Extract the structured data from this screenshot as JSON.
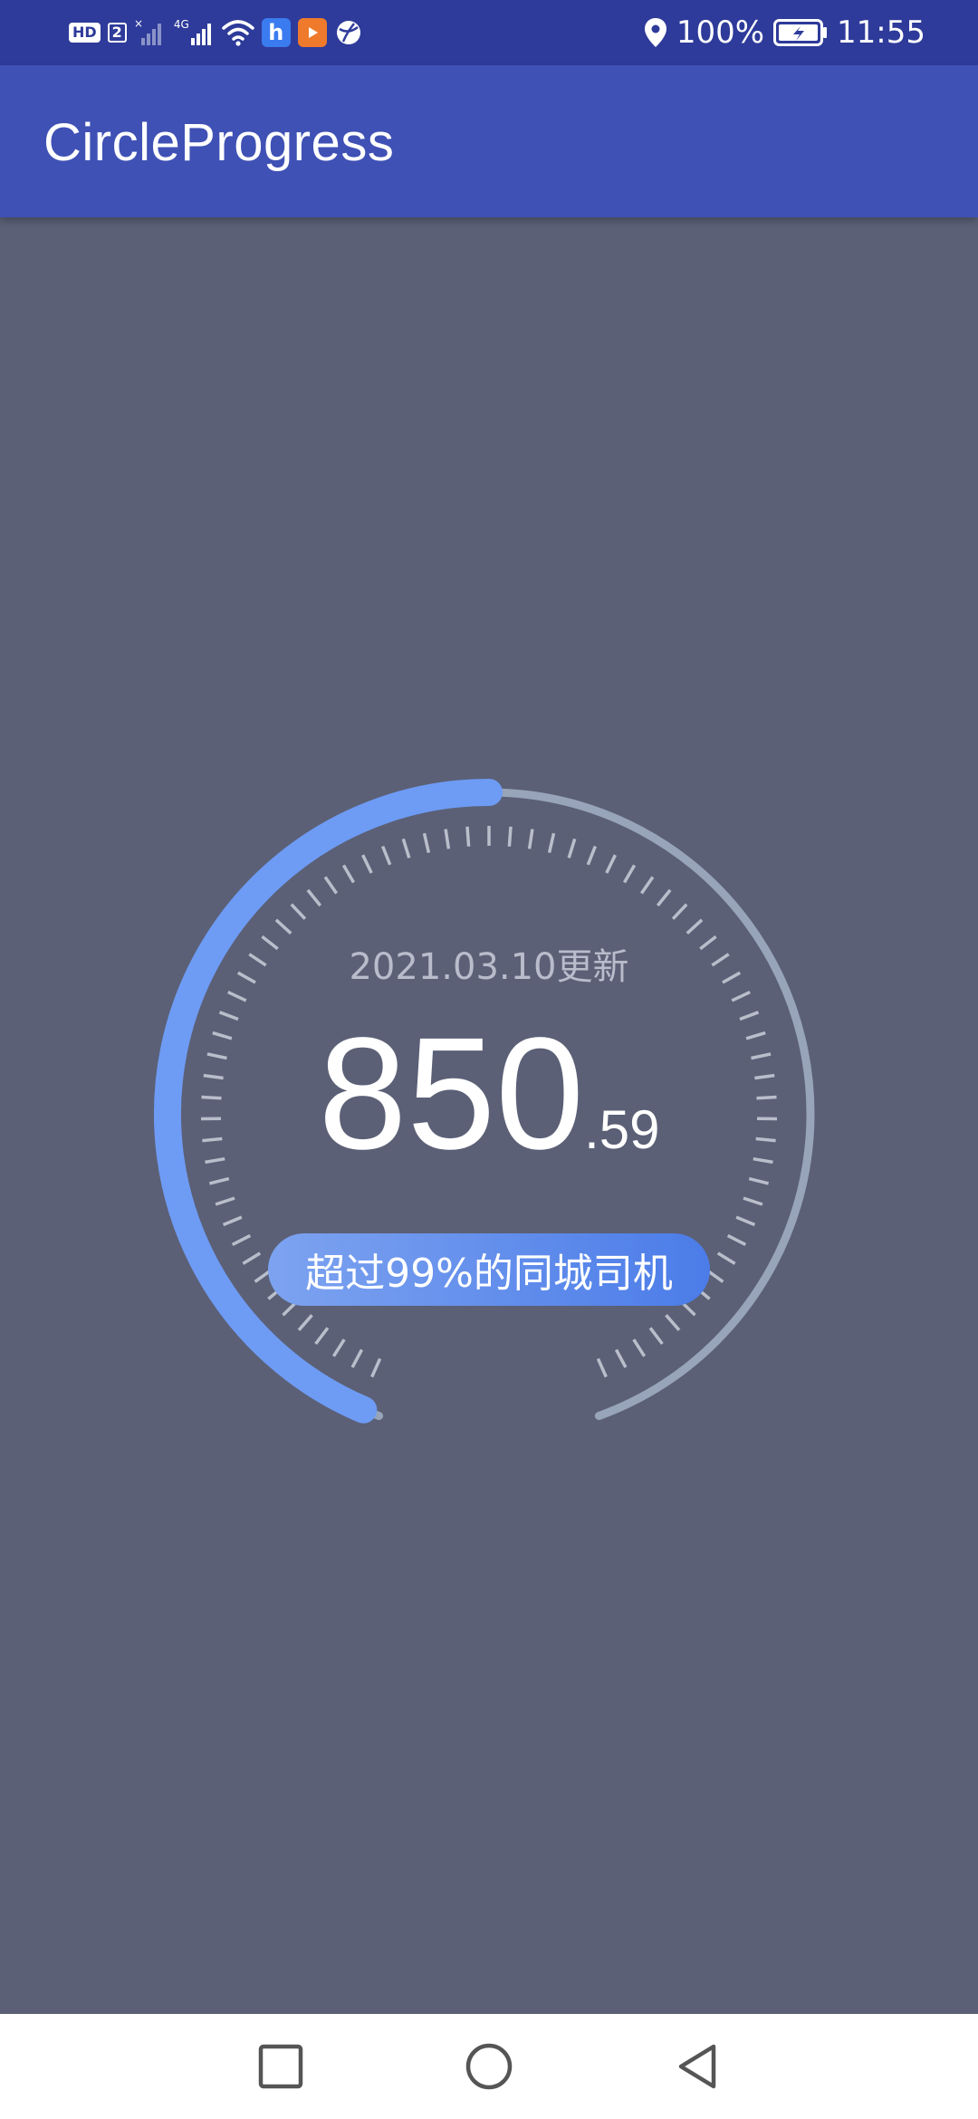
{
  "status_bar": {
    "left_icons": [
      "hd-icon",
      "sim-2-icon",
      "signal-no-sim-icon",
      "signal-4g-icon",
      "wifi-icon",
      "app-h-icon",
      "app-play-icon",
      "app-globe-icon"
    ],
    "hd": "HD",
    "sim": "2",
    "network": "4G",
    "battery": "100%",
    "time": "11:55",
    "right_icons": [
      "location-icon",
      "battery-charging-icon"
    ]
  },
  "app_bar": {
    "title": "CircleProgress"
  },
  "gauge": {
    "update_text": "2021.03.10更新",
    "score_main": "850",
    "score_decimal": ".59",
    "rank_text": "超过99%的同城司机",
    "progress_fraction": 0.5,
    "colors": {
      "progress": "#6e9bf4",
      "track": "#97a4b9",
      "ticks": "#b9becb",
      "badge_start": "#7da3f0",
      "badge_end": "#4b7ce8"
    }
  },
  "nav_bar": {
    "icons": [
      "recent-apps-icon",
      "home-icon",
      "back-icon"
    ]
  }
}
